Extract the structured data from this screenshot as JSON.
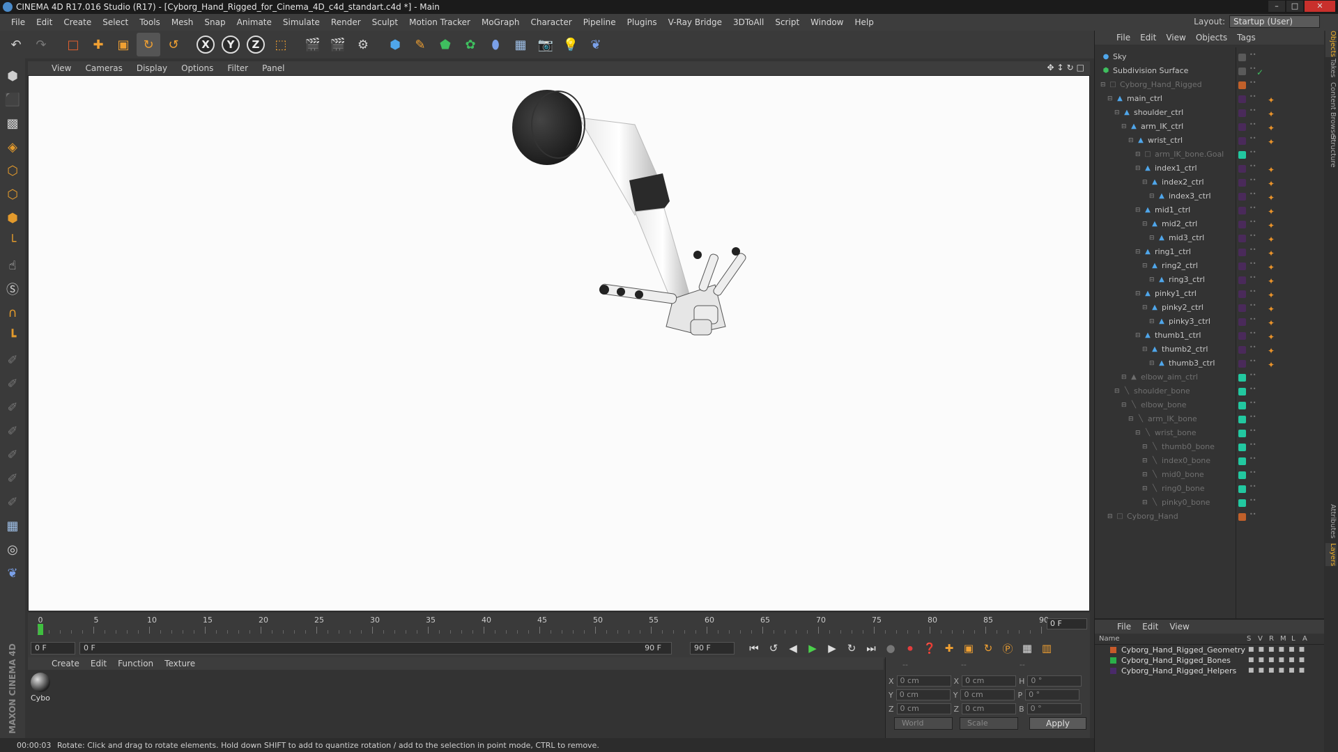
{
  "window": {
    "title": "CINEMA 4D R17.016 Studio (R17) - [Cyborg_Hand_Rigged_for_Cinema_4D_c4d_standart.c4d *] - Main",
    "buttons": [
      "–",
      "□",
      "✕"
    ]
  },
  "menubar": {
    "items": [
      "File",
      "Edit",
      "Create",
      "Select",
      "Tools",
      "Mesh",
      "Snap",
      "Animate",
      "Simulate",
      "Render",
      "Sculpt",
      "Motion Tracker",
      "MoGraph",
      "Character",
      "Pipeline",
      "Plugins",
      "V-Ray Bridge",
      "3DToAll",
      "Script",
      "Window",
      "Help"
    ],
    "layout_label": "Layout:",
    "layout_value": "Startup (User)"
  },
  "toolbar": {
    "axis_x": "X",
    "axis_y": "Y",
    "axis_z": "Z"
  },
  "viewport": {
    "menu": [
      "View",
      "Cameras",
      "Display",
      "Options",
      "Filter",
      "Panel"
    ]
  },
  "timeline": {
    "labels": [
      "0",
      "5",
      "10",
      "15",
      "20",
      "25",
      "30",
      "35",
      "40",
      "45",
      "50",
      "55",
      "60",
      "65",
      "70",
      "75",
      "80",
      "85",
      "90"
    ],
    "current_frame": "0 F",
    "start_field": "0 F",
    "range_start": "0 F",
    "range_end": "90 F",
    "end_field": "90 F"
  },
  "material": {
    "menu": [
      "Create",
      "Edit",
      "Function",
      "Texture"
    ],
    "items": [
      {
        "name": "Cybo"
      }
    ]
  },
  "coordinates": {
    "headers": [
      "--",
      "--",
      "--"
    ],
    "rows": [
      {
        "a": "X",
        "av": "0 cm",
        "b": "X",
        "bv": "0 cm",
        "c": "H",
        "cv": "0 °"
      },
      {
        "a": "Y",
        "av": "0 cm",
        "b": "Y",
        "bv": "0 cm",
        "c": "P",
        "cv": "0 °"
      },
      {
        "a": "Z",
        "av": "0 cm",
        "b": "Z",
        "bv": "0 cm",
        "c": "B",
        "cv": "0 °"
      }
    ],
    "space": "World",
    "mode": "Scale",
    "apply": "Apply"
  },
  "status": {
    "time": "00:00:03",
    "message": "Rotate: Click and drag to rotate elements. Hold down SHIFT to add to quantize rotation / add to the selection in point mode, CTRL to remove."
  },
  "objects": {
    "menu": [
      "File",
      "Edit",
      "View",
      "Objects",
      "Tags"
    ],
    "items": [
      {
        "name": "Sky",
        "depth": 0,
        "dim": false,
        "icon": "sky-icon",
        "tag": "#5a5a5a",
        "extra": ""
      },
      {
        "name": "Subdivision Surface",
        "depth": 0,
        "dim": false,
        "icon": "subdivision-icon",
        "tag": "#5a5a5a",
        "extra": "✓"
      },
      {
        "name": "Cyborg_Hand_Rigged",
        "depth": 1,
        "dim": true,
        "icon": "null-icon",
        "tag": "#c0602a",
        "extra": ""
      },
      {
        "name": "main_ctrl",
        "depth": 2,
        "dim": false,
        "icon": "joint-icon",
        "tag": "#4a2a5a",
        "extra": "✦"
      },
      {
        "name": "shoulder_ctrl",
        "depth": 3,
        "dim": false,
        "icon": "joint-icon",
        "tag": "#4a2a5a",
        "extra": "✦"
      },
      {
        "name": "arm_IK_ctrl",
        "depth": 4,
        "dim": false,
        "icon": "joint-icon",
        "tag": "#4a2a5a",
        "extra": "✦"
      },
      {
        "name": "wrist_ctrl",
        "depth": 5,
        "dim": false,
        "icon": "joint-icon",
        "tag": "#4a2a5a",
        "extra": "✦"
      },
      {
        "name": "arm_IK_bone.Goal",
        "depth": 6,
        "dim": true,
        "icon": "null-icon",
        "tag": "#22c8a0",
        "extra": ""
      },
      {
        "name": "index1_ctrl",
        "depth": 6,
        "dim": false,
        "icon": "joint-icon",
        "tag": "#4a2a5a",
        "extra": "✦"
      },
      {
        "name": "index2_ctrl",
        "depth": 7,
        "dim": false,
        "icon": "joint-icon",
        "tag": "#4a2a5a",
        "extra": "✦"
      },
      {
        "name": "index3_ctrl",
        "depth": 8,
        "dim": false,
        "icon": "joint-icon",
        "tag": "#4a2a5a",
        "extra": "✦"
      },
      {
        "name": "mid1_ctrl",
        "depth": 6,
        "dim": false,
        "icon": "joint-icon",
        "tag": "#4a2a5a",
        "extra": "✦"
      },
      {
        "name": "mid2_ctrl",
        "depth": 7,
        "dim": false,
        "icon": "joint-icon",
        "tag": "#4a2a5a",
        "extra": "✦"
      },
      {
        "name": "mid3_ctrl",
        "depth": 8,
        "dim": false,
        "icon": "joint-icon",
        "tag": "#4a2a5a",
        "extra": "✦"
      },
      {
        "name": "ring1_ctrl",
        "depth": 6,
        "dim": false,
        "icon": "joint-icon",
        "tag": "#4a2a5a",
        "extra": "✦"
      },
      {
        "name": "ring2_ctrl",
        "depth": 7,
        "dim": false,
        "icon": "joint-icon",
        "tag": "#4a2a5a",
        "extra": "✦"
      },
      {
        "name": "ring3_ctrl",
        "depth": 8,
        "dim": false,
        "icon": "joint-icon",
        "tag": "#4a2a5a",
        "extra": "✦"
      },
      {
        "name": "pinky1_ctrl",
        "depth": 6,
        "dim": false,
        "icon": "joint-icon",
        "tag": "#4a2a5a",
        "extra": "✦"
      },
      {
        "name": "pinky2_ctrl",
        "depth": 7,
        "dim": false,
        "icon": "joint-icon",
        "tag": "#4a2a5a",
        "extra": "✦"
      },
      {
        "name": "pinky3_ctrl",
        "depth": 8,
        "dim": false,
        "icon": "joint-icon",
        "tag": "#4a2a5a",
        "extra": "✦"
      },
      {
        "name": "thumb1_ctrl",
        "depth": 6,
        "dim": false,
        "icon": "joint-icon",
        "tag": "#4a2a5a",
        "extra": "✦"
      },
      {
        "name": "thumb2_ctrl",
        "depth": 7,
        "dim": false,
        "icon": "joint-icon",
        "tag": "#4a2a5a",
        "extra": "✦"
      },
      {
        "name": "thumb3_ctrl",
        "depth": 8,
        "dim": false,
        "icon": "joint-icon",
        "tag": "#4a2a5a",
        "extra": "✦"
      },
      {
        "name": "elbow_aim_ctrl",
        "depth": 4,
        "dim": true,
        "icon": "joint-icon",
        "tag": "#22c8a0",
        "extra": ""
      },
      {
        "name": "shoulder_bone",
        "depth": 3,
        "dim": true,
        "icon": "bone-icon",
        "tag": "#22c8a0",
        "extra": ""
      },
      {
        "name": "elbow_bone",
        "depth": 4,
        "dim": true,
        "icon": "bone-icon",
        "tag": "#22c8a0",
        "extra": ""
      },
      {
        "name": "arm_IK_bone",
        "depth": 5,
        "dim": true,
        "icon": "bone-icon",
        "tag": "#22c8a0",
        "extra": ""
      },
      {
        "name": "wrist_bone",
        "depth": 6,
        "dim": true,
        "icon": "bone-icon",
        "tag": "#22c8a0",
        "extra": ""
      },
      {
        "name": "thumb0_bone",
        "depth": 7,
        "dim": true,
        "icon": "bone-icon",
        "tag": "#22c8a0",
        "extra": ""
      },
      {
        "name": "index0_bone",
        "depth": 7,
        "dim": true,
        "icon": "bone-icon",
        "tag": "#22c8a0",
        "extra": ""
      },
      {
        "name": "mid0_bone",
        "depth": 7,
        "dim": true,
        "icon": "bone-icon",
        "tag": "#22c8a0",
        "extra": ""
      },
      {
        "name": "ring0_bone",
        "depth": 7,
        "dim": true,
        "icon": "bone-icon",
        "tag": "#22c8a0",
        "extra": ""
      },
      {
        "name": "pinky0_bone",
        "depth": 7,
        "dim": true,
        "icon": "bone-icon",
        "tag": "#22c8a0",
        "extra": ""
      },
      {
        "name": "Cyborg_Hand",
        "depth": 2,
        "dim": true,
        "icon": "null-icon",
        "tag": "#c0602a",
        "extra": ""
      }
    ]
  },
  "layers": {
    "menu": [
      "File",
      "Edit",
      "View"
    ],
    "header": {
      "name": "Name",
      "s": "S",
      "v": "V",
      "r": "R",
      "m": "M",
      "l": "L",
      "a": "A"
    },
    "items": [
      {
        "name": "Cyborg_Hand_Rigged_Geometry",
        "color": "#c85a2a"
      },
      {
        "name": "Cyborg_Hand_Rigged_Bones",
        "color": "#2ab04a"
      },
      {
        "name": "Cyborg_Hand_Rigged_Helpers",
        "color": "#4a2a6a"
      }
    ]
  },
  "side_tabs": [
    "Objects",
    "Takes",
    "Content Browser",
    "Structure",
    "Attributes",
    "Layers"
  ]
}
